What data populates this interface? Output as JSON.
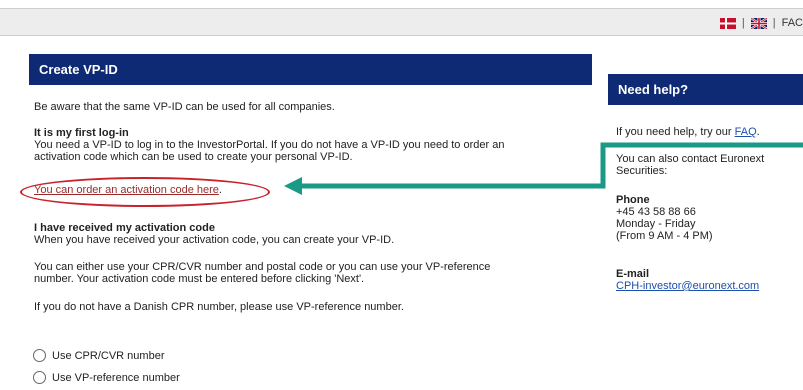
{
  "top": {
    "flag_dk": "dk-flag-icon",
    "flag_uk": "uk-flag-icon",
    "sep": "|",
    "faq": "FAC"
  },
  "main": {
    "title": "Create VP-ID",
    "intro": "Be aware that the same VP-ID can be used for all companies.",
    "first_heading": "It is my first log-in",
    "first_line1": "You need a VP-ID to log in to the InvestorPortal. If you do not have a VP-ID you need to order an",
    "first_line2": "activation code which can be used to create your personal VP-ID.",
    "order_link": "You can order an activation code here",
    "order_period": ".",
    "received_heading": "I have received my activation code",
    "received_line": "When you have received your activation code, you can create your VP-ID.",
    "either_line1": "You can either use your CPR/CVR number and postal code or you can use your VP-reference",
    "either_line2": "number. Your activation code must be entered before clicking 'Next'.",
    "no_cpr": "If you do not have a Danish CPR number, please use VP-reference number.",
    "option_cpr": "Use CPR/CVR number",
    "option_vp": "Use VP-reference number"
  },
  "help": {
    "title": "Need help?",
    "try_prefix": "If you need help, try our ",
    "faq_link": "FAQ",
    "try_suffix": ".",
    "contact_line1": "You can also contact Euronext",
    "contact_line2": "Securities:",
    "phone_label": "Phone",
    "phone_number": "+45 43 58 88 66",
    "phone_days": "Monday - Friday",
    "phone_hours": "(From 9 AM - 4 PM)",
    "email_label": "E-mail",
    "email_address": "CPH-investor@euronext.com"
  },
  "annotation": {
    "highlight_color": "#c8232c",
    "arrow_color": "#1a9a86"
  }
}
